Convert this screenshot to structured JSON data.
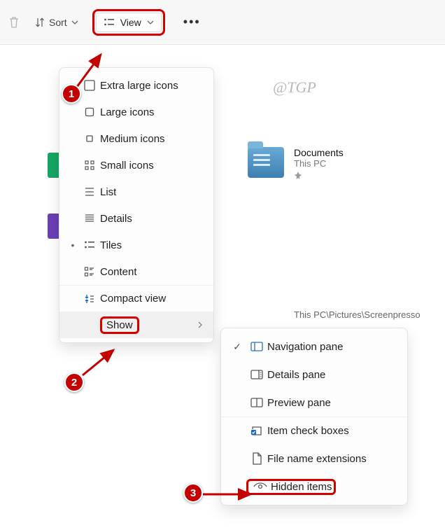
{
  "toolbar": {
    "sort_label": "Sort",
    "view_label": "View"
  },
  "watermark": "@TGP",
  "view_menu": {
    "items": [
      {
        "label": "Extra large icons"
      },
      {
        "label": "Large icons"
      },
      {
        "label": "Medium icons"
      },
      {
        "label": "Small icons"
      },
      {
        "label": "List"
      },
      {
        "label": "Details"
      },
      {
        "label": "Tiles"
      },
      {
        "label": "Content"
      }
    ],
    "compact_label": "Compact view",
    "show_label": "Show"
  },
  "show_submenu": {
    "items": [
      {
        "label": "Navigation pane",
        "checked": true
      },
      {
        "label": "Details pane",
        "checked": false
      },
      {
        "label": "Preview pane",
        "checked": false
      },
      {
        "label": "Item check boxes",
        "checked": false
      },
      {
        "label": "File name extensions",
        "checked": false
      },
      {
        "label": "Hidden items",
        "checked": false
      }
    ]
  },
  "documents_tile": {
    "name": "Documents",
    "location": "This PC"
  },
  "path_caption": "This PC\\Pictures\\Screenpresso",
  "annotations": {
    "n1": "1",
    "n2": "2",
    "n3": "3"
  }
}
